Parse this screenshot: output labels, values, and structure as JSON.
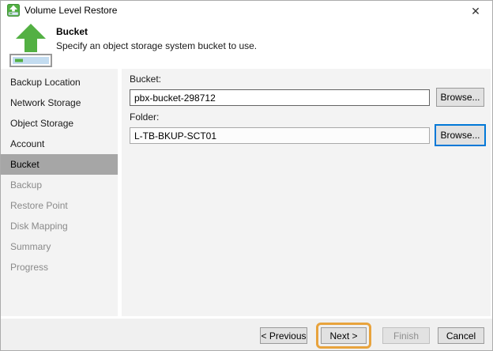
{
  "window": {
    "title": "Volume Level Restore",
    "close_glyph": "✕"
  },
  "header": {
    "title": "Bucket",
    "subtitle": "Specify an object storage system bucket to use."
  },
  "sidebar": {
    "items": [
      {
        "label": "Backup Location",
        "state": "done"
      },
      {
        "label": "Network Storage",
        "state": "done"
      },
      {
        "label": "Object Storage",
        "state": "done"
      },
      {
        "label": "Account",
        "state": "done"
      },
      {
        "label": "Bucket",
        "state": "current"
      },
      {
        "label": "Backup",
        "state": "todo"
      },
      {
        "label": "Restore Point",
        "state": "todo"
      },
      {
        "label": "Disk Mapping",
        "state": "todo"
      },
      {
        "label": "Summary",
        "state": "todo"
      },
      {
        "label": "Progress",
        "state": "todo"
      }
    ]
  },
  "form": {
    "bucket_label": "Bucket:",
    "bucket_value": "pbx-bucket-298712",
    "bucket_browse_label": "Browse...",
    "folder_label": "Folder:",
    "folder_value": "L-TB-BKUP-SCT01",
    "folder_browse_label": "Browse..."
  },
  "footer": {
    "previous_label": "< Previous",
    "next_label": "Next >",
    "finish_label": "Finish",
    "finish_disabled": "true",
    "cancel_label": "Cancel"
  },
  "colors": {
    "accent_green": "#53b043",
    "volume_fill_blue": "#c3dcf0",
    "highlight_orange": "#e8a33d",
    "focus_blue": "#0078d7",
    "selected_step_gray": "#a6a6a6"
  }
}
